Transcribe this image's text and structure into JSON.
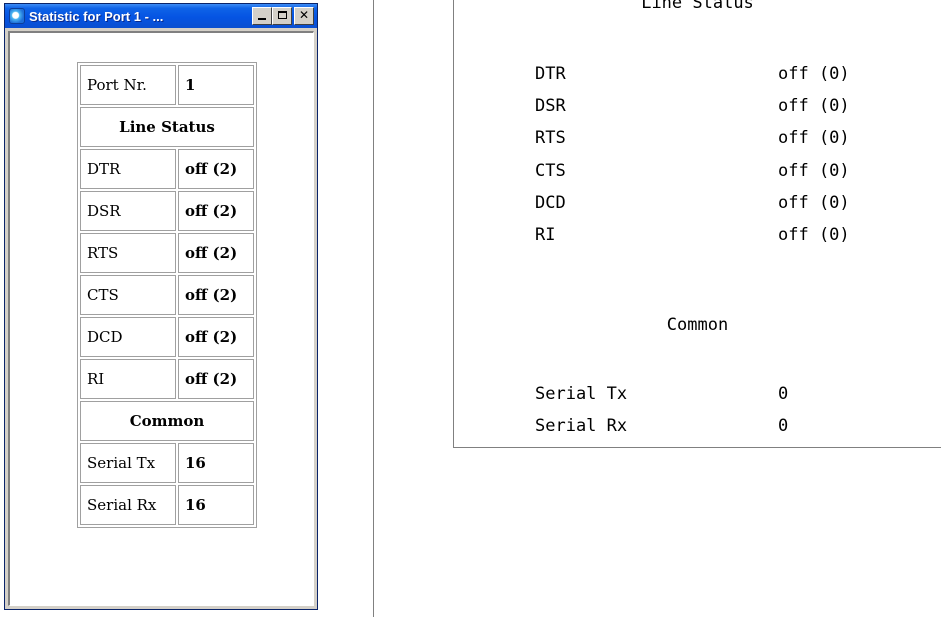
{
  "window": {
    "title": "Statistic for Port 1 - ..."
  },
  "table": {
    "port": {
      "label": "Port Nr.",
      "value": "1"
    },
    "line_status_header": "Line Status",
    "signals": [
      {
        "label": "DTR",
        "value": "off (2)"
      },
      {
        "label": "DSR",
        "value": "off (2)"
      },
      {
        "label": "RTS",
        "value": "off (2)"
      },
      {
        "label": "CTS",
        "value": "off (2)"
      },
      {
        "label": "DCD",
        "value": "off (2)"
      },
      {
        "label": "RI",
        "value": "off (2)"
      }
    ],
    "common_header": "Common",
    "counters": [
      {
        "label": "Serial Tx",
        "value": "16"
      },
      {
        "label": "Serial Rx",
        "value": "16"
      }
    ]
  },
  "text_view": {
    "line_status_header": "Line Status",
    "signals": [
      {
        "label": "DTR",
        "value": "off (0)"
      },
      {
        "label": "DSR",
        "value": "off (0)"
      },
      {
        "label": "RTS",
        "value": "off (0)"
      },
      {
        "label": "CTS",
        "value": "off (0)"
      },
      {
        "label": "DCD",
        "value": "off (0)"
      },
      {
        "label": "RI",
        "value": "off (0)"
      }
    ],
    "common_header": "Common",
    "counters": [
      {
        "label": "Serial Tx",
        "value": "0"
      },
      {
        "label": "Serial Rx",
        "value": "0"
      }
    ]
  }
}
